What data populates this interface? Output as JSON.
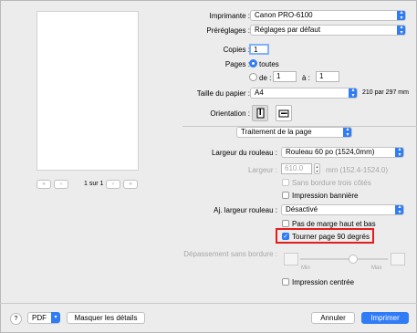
{
  "printer": {
    "label": "Imprimante :",
    "value": "Canon PRO-6100"
  },
  "presets": {
    "label": "Préréglages :",
    "value": "Réglages par défaut"
  },
  "copies": {
    "label": "Copies :",
    "value": "1"
  },
  "pages": {
    "label": "Pages :",
    "all_label": "toutes",
    "from_label": "de :",
    "from_value": "1",
    "to_label": "à :",
    "to_value": "1"
  },
  "paper": {
    "label": "Taille du papier :",
    "value": "A4",
    "size_text": "210 par 297 mm"
  },
  "orientation": {
    "label": "Orientation :"
  },
  "section": {
    "value": "Traitement de la page"
  },
  "preview": {
    "page_text": "1 sur 1"
  },
  "roll": {
    "width_label": "Largeur du rouleau :",
    "width_value": "Rouleau 60 po (1524,0mm)",
    "custom_label": "Largeur :",
    "custom_value": "610.0",
    "custom_unit": "mm (152.4-1524.0)",
    "three_sides_label": "Sans bordure trois côtés",
    "banner_label": "Impression bannière",
    "adjust_label": "Aj. largeur rouleau :",
    "adjust_value": "Désactivé",
    "no_margin_label": "Pas de marge haut et bas",
    "rotate_label": "Tourner page 90 degrés",
    "overflow_label": "Dépassement sans bordure :",
    "slider_min": "Min",
    "slider_max": "Max",
    "centered_label": "Impression centrée"
  },
  "footer": {
    "help": "?",
    "pdf_label": "PDF",
    "details_label": "Masquer les détails",
    "cancel_label": "Annuler",
    "print_label": "Imprimer"
  },
  "colors": {
    "accent": "#2f7cf6",
    "highlight": "#e31c1c"
  }
}
